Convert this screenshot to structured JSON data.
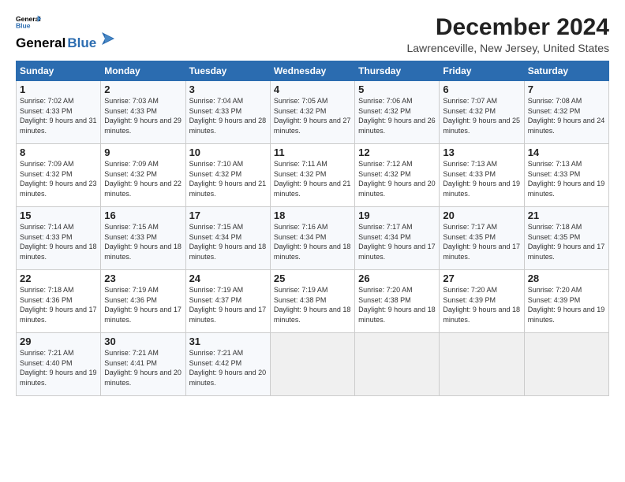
{
  "header": {
    "logo_line1": "General",
    "logo_line2": "Blue",
    "main_title": "December 2024",
    "subtitle": "Lawrenceville, New Jersey, United States"
  },
  "days_of_week": [
    "Sunday",
    "Monday",
    "Tuesday",
    "Wednesday",
    "Thursday",
    "Friday",
    "Saturday"
  ],
  "weeks": [
    [
      {
        "day": "1",
        "sunrise": "Sunrise: 7:02 AM",
        "sunset": "Sunset: 4:33 PM",
        "daylight": "Daylight: 9 hours and 31 minutes."
      },
      {
        "day": "2",
        "sunrise": "Sunrise: 7:03 AM",
        "sunset": "Sunset: 4:33 PM",
        "daylight": "Daylight: 9 hours and 29 minutes."
      },
      {
        "day": "3",
        "sunrise": "Sunrise: 7:04 AM",
        "sunset": "Sunset: 4:33 PM",
        "daylight": "Daylight: 9 hours and 28 minutes."
      },
      {
        "day": "4",
        "sunrise": "Sunrise: 7:05 AM",
        "sunset": "Sunset: 4:32 PM",
        "daylight": "Daylight: 9 hours and 27 minutes."
      },
      {
        "day": "5",
        "sunrise": "Sunrise: 7:06 AM",
        "sunset": "Sunset: 4:32 PM",
        "daylight": "Daylight: 9 hours and 26 minutes."
      },
      {
        "day": "6",
        "sunrise": "Sunrise: 7:07 AM",
        "sunset": "Sunset: 4:32 PM",
        "daylight": "Daylight: 9 hours and 25 minutes."
      },
      {
        "day": "7",
        "sunrise": "Sunrise: 7:08 AM",
        "sunset": "Sunset: 4:32 PM",
        "daylight": "Daylight: 9 hours and 24 minutes."
      }
    ],
    [
      {
        "day": "8",
        "sunrise": "Sunrise: 7:09 AM",
        "sunset": "Sunset: 4:32 PM",
        "daylight": "Daylight: 9 hours and 23 minutes."
      },
      {
        "day": "9",
        "sunrise": "Sunrise: 7:09 AM",
        "sunset": "Sunset: 4:32 PM",
        "daylight": "Daylight: 9 hours and 22 minutes."
      },
      {
        "day": "10",
        "sunrise": "Sunrise: 7:10 AM",
        "sunset": "Sunset: 4:32 PM",
        "daylight": "Daylight: 9 hours and 21 minutes."
      },
      {
        "day": "11",
        "sunrise": "Sunrise: 7:11 AM",
        "sunset": "Sunset: 4:32 PM",
        "daylight": "Daylight: 9 hours and 21 minutes."
      },
      {
        "day": "12",
        "sunrise": "Sunrise: 7:12 AM",
        "sunset": "Sunset: 4:32 PM",
        "daylight": "Daylight: 9 hours and 20 minutes."
      },
      {
        "day": "13",
        "sunrise": "Sunrise: 7:13 AM",
        "sunset": "Sunset: 4:33 PM",
        "daylight": "Daylight: 9 hours and 19 minutes."
      },
      {
        "day": "14",
        "sunrise": "Sunrise: 7:13 AM",
        "sunset": "Sunset: 4:33 PM",
        "daylight": "Daylight: 9 hours and 19 minutes."
      }
    ],
    [
      {
        "day": "15",
        "sunrise": "Sunrise: 7:14 AM",
        "sunset": "Sunset: 4:33 PM",
        "daylight": "Daylight: 9 hours and 18 minutes."
      },
      {
        "day": "16",
        "sunrise": "Sunrise: 7:15 AM",
        "sunset": "Sunset: 4:33 PM",
        "daylight": "Daylight: 9 hours and 18 minutes."
      },
      {
        "day": "17",
        "sunrise": "Sunrise: 7:15 AM",
        "sunset": "Sunset: 4:34 PM",
        "daylight": "Daylight: 9 hours and 18 minutes."
      },
      {
        "day": "18",
        "sunrise": "Sunrise: 7:16 AM",
        "sunset": "Sunset: 4:34 PM",
        "daylight": "Daylight: 9 hours and 18 minutes."
      },
      {
        "day": "19",
        "sunrise": "Sunrise: 7:17 AM",
        "sunset": "Sunset: 4:34 PM",
        "daylight": "Daylight: 9 hours and 17 minutes."
      },
      {
        "day": "20",
        "sunrise": "Sunrise: 7:17 AM",
        "sunset": "Sunset: 4:35 PM",
        "daylight": "Daylight: 9 hours and 17 minutes."
      },
      {
        "day": "21",
        "sunrise": "Sunrise: 7:18 AM",
        "sunset": "Sunset: 4:35 PM",
        "daylight": "Daylight: 9 hours and 17 minutes."
      }
    ],
    [
      {
        "day": "22",
        "sunrise": "Sunrise: 7:18 AM",
        "sunset": "Sunset: 4:36 PM",
        "daylight": "Daylight: 9 hours and 17 minutes."
      },
      {
        "day": "23",
        "sunrise": "Sunrise: 7:19 AM",
        "sunset": "Sunset: 4:36 PM",
        "daylight": "Daylight: 9 hours and 17 minutes."
      },
      {
        "day": "24",
        "sunrise": "Sunrise: 7:19 AM",
        "sunset": "Sunset: 4:37 PM",
        "daylight": "Daylight: 9 hours and 17 minutes."
      },
      {
        "day": "25",
        "sunrise": "Sunrise: 7:19 AM",
        "sunset": "Sunset: 4:38 PM",
        "daylight": "Daylight: 9 hours and 18 minutes."
      },
      {
        "day": "26",
        "sunrise": "Sunrise: 7:20 AM",
        "sunset": "Sunset: 4:38 PM",
        "daylight": "Daylight: 9 hours and 18 minutes."
      },
      {
        "day": "27",
        "sunrise": "Sunrise: 7:20 AM",
        "sunset": "Sunset: 4:39 PM",
        "daylight": "Daylight: 9 hours and 18 minutes."
      },
      {
        "day": "28",
        "sunrise": "Sunrise: 7:20 AM",
        "sunset": "Sunset: 4:39 PM",
        "daylight": "Daylight: 9 hours and 19 minutes."
      }
    ],
    [
      {
        "day": "29",
        "sunrise": "Sunrise: 7:21 AM",
        "sunset": "Sunset: 4:40 PM",
        "daylight": "Daylight: 9 hours and 19 minutes."
      },
      {
        "day": "30",
        "sunrise": "Sunrise: 7:21 AM",
        "sunset": "Sunset: 4:41 PM",
        "daylight": "Daylight: 9 hours and 20 minutes."
      },
      {
        "day": "31",
        "sunrise": "Sunrise: 7:21 AM",
        "sunset": "Sunset: 4:42 PM",
        "daylight": "Daylight: 9 hours and 20 minutes."
      },
      null,
      null,
      null,
      null
    ]
  ]
}
